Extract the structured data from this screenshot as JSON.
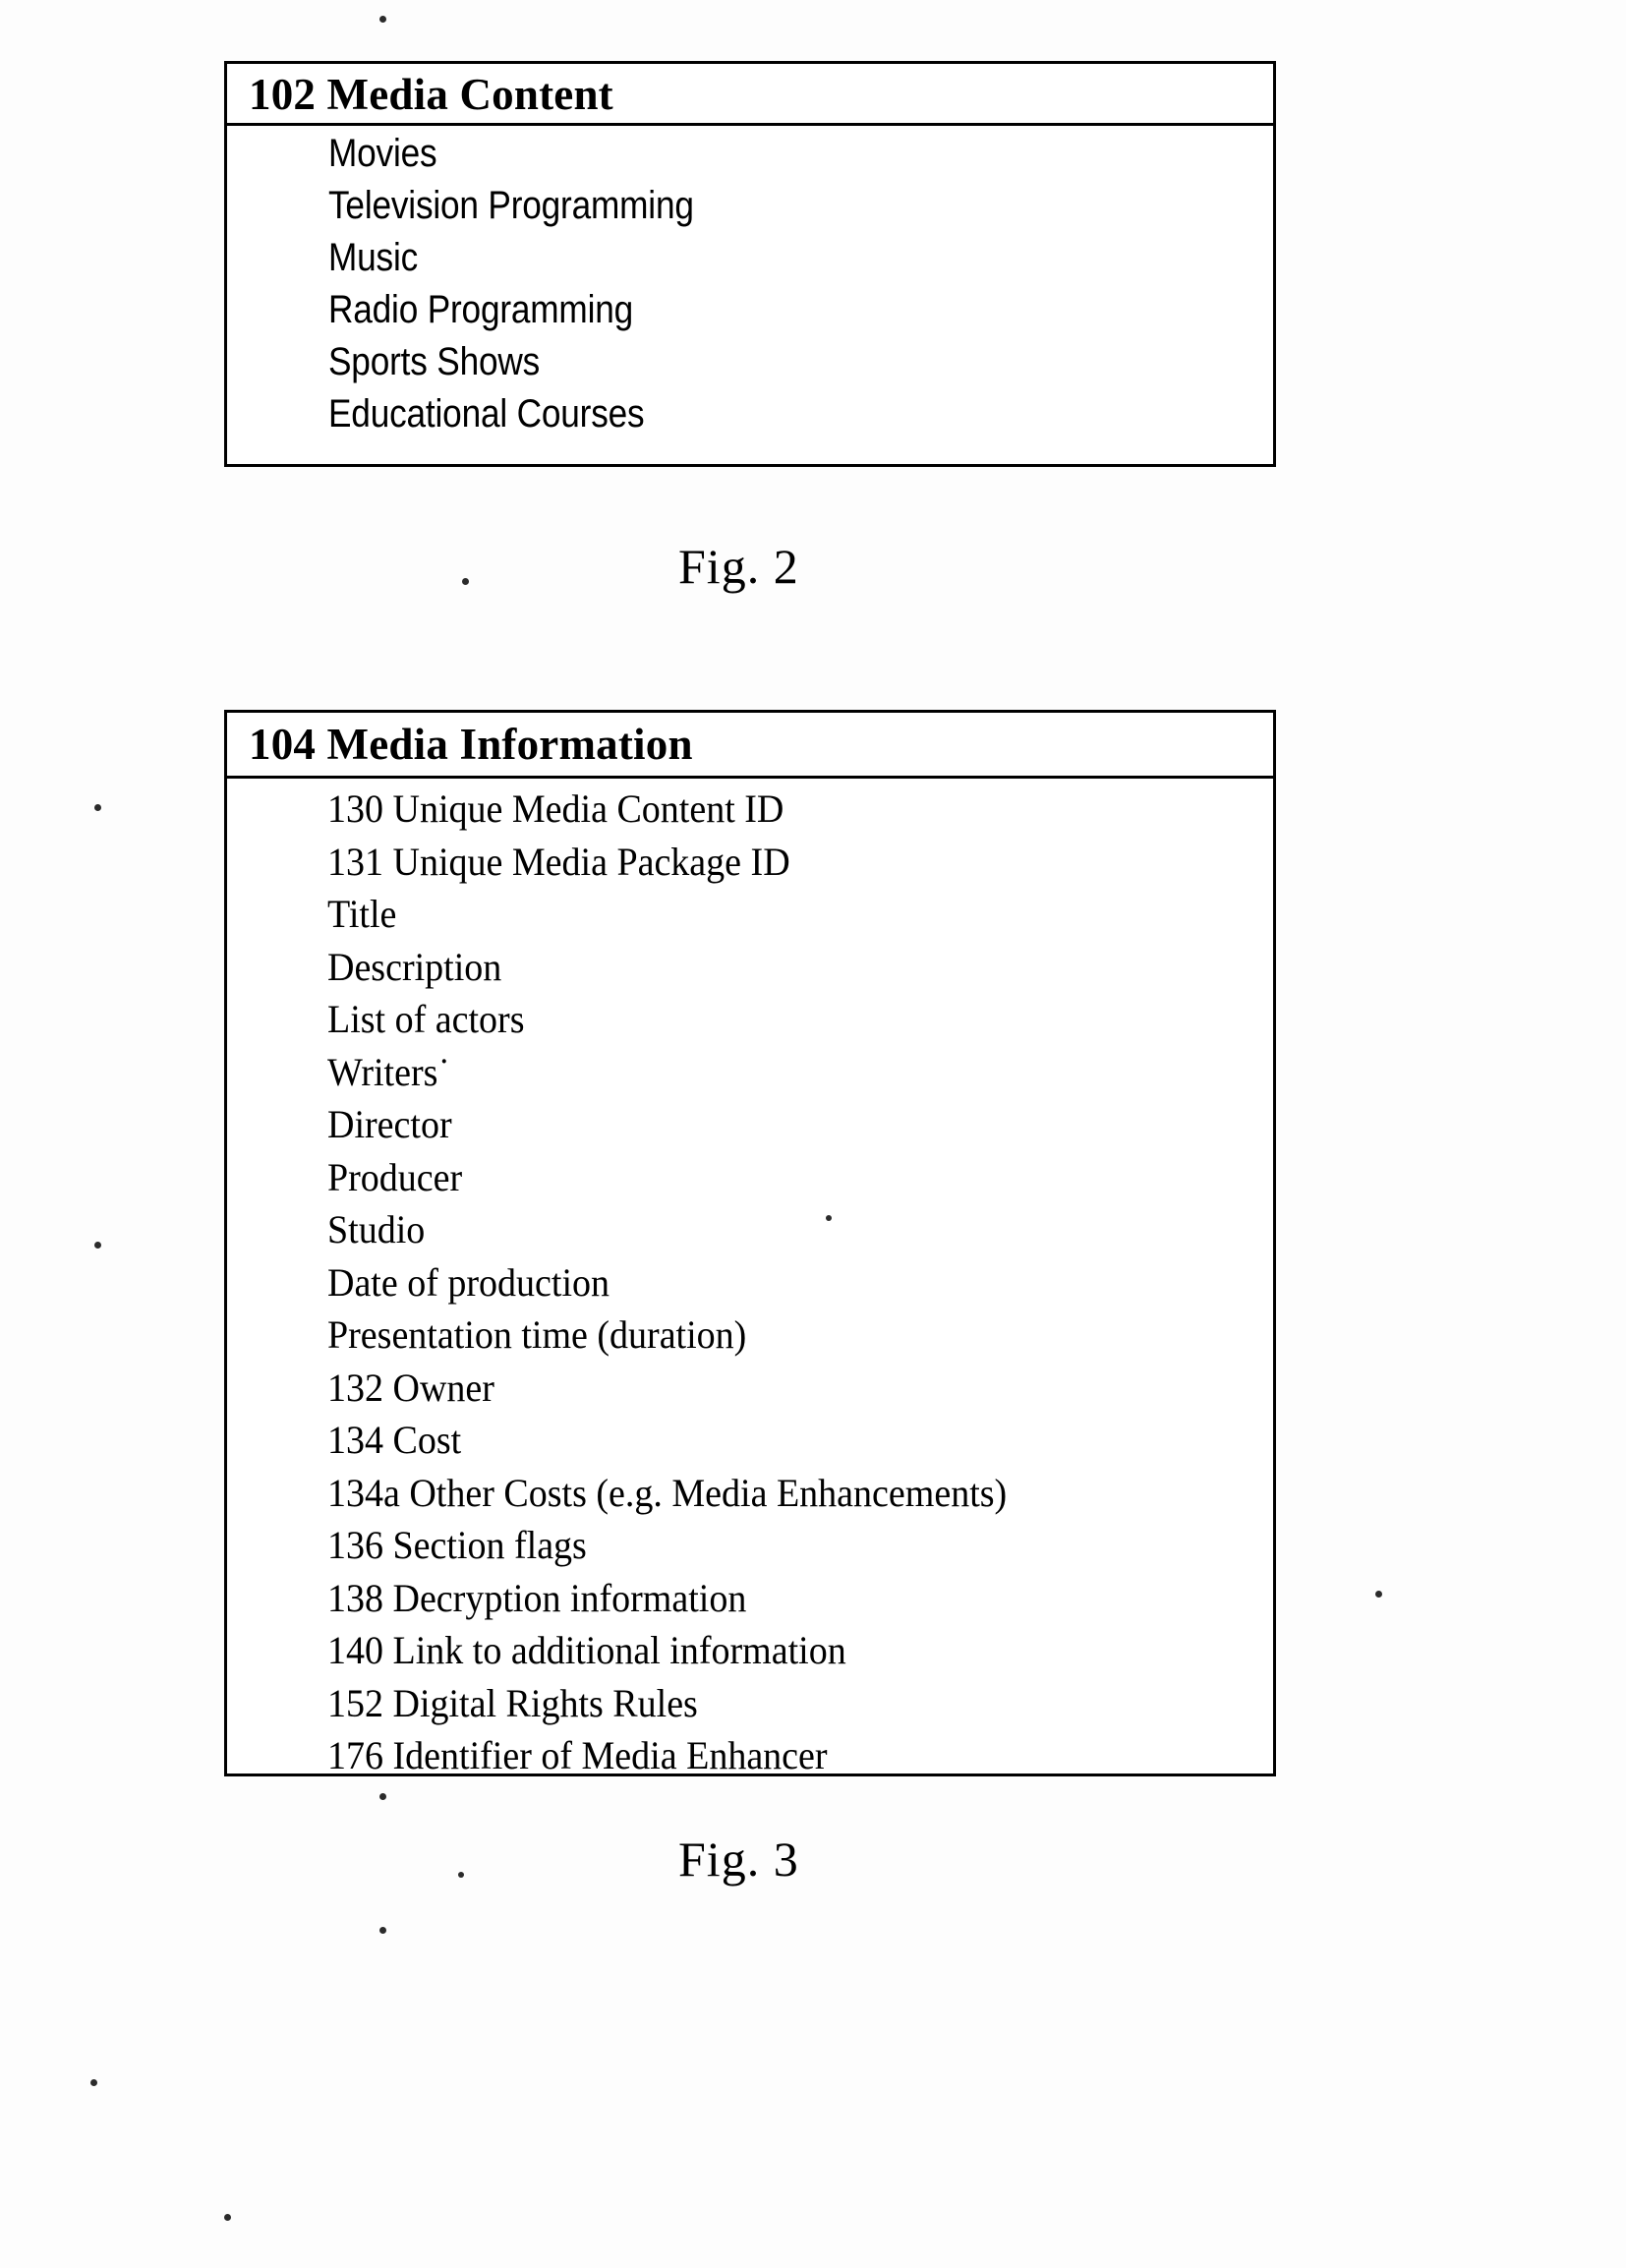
{
  "document": {
    "type": "patent-figure-sheet"
  },
  "figures": [
    {
      "id": "fig2",
      "caption": "Fig. 2",
      "header": "102 Media Content",
      "items": [
        "Movies",
        "Television Programming",
        "Music",
        "Radio Programming",
        "Sports Shows",
        "Educational Courses"
      ]
    },
    {
      "id": "fig3",
      "caption": "Fig. 3",
      "header": "104 Media Information",
      "items": [
        "130 Unique Media Content ID",
        "131 Unique Media Package ID",
        "Title",
        "Description",
        "List of actors",
        "Writers˙",
        "Director",
        "Producer",
        "Studio",
        "Date of production",
        "Presentation time (duration)",
        "132 Owner",
        "134 Cost",
        "134a Other Costs (e.g. Media Enhancements)",
        "136 Section flags",
        "138 Decryption information",
        "140 Link to additional information",
        "152 Digital Rights Rules",
        "176 Identifier of Media Enhancer"
      ]
    }
  ],
  "colors": {
    "ink": "#000000",
    "paper": "#ffffff"
  }
}
